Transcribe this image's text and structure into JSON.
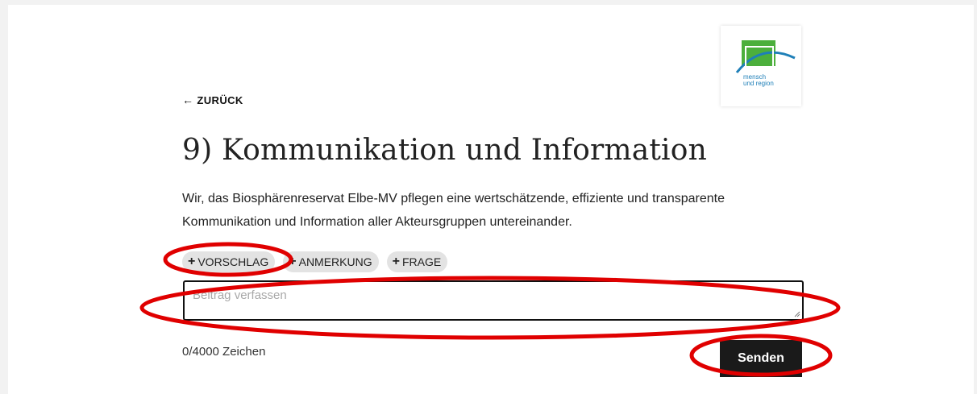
{
  "logo": {
    "line1": "mensch",
    "line2": "und region",
    "brand_green": "#4caf3c",
    "brand_blue": "#1e7fb8"
  },
  "nav": {
    "back_label": "ZURÜCK",
    "back_icon": "arrow-left-icon"
  },
  "main": {
    "title": "9) Kommunikation und Information",
    "description": "Wir, das Biosphärenreservat Elbe-MV pflegen eine wertschätzende, effiziente und transparente Kommunikation und Information aller Akteursgruppen untereinander."
  },
  "chips": [
    {
      "label": "VORSCHLAG",
      "icon": "plus-icon"
    },
    {
      "label": "ANMERKUNG",
      "icon": "plus-icon"
    },
    {
      "label": "FRAGE",
      "icon": "plus-icon"
    }
  ],
  "composer": {
    "value": "",
    "placeholder": "Beitrag verfassen",
    "counter": "0/4000 Zeichen",
    "send_label": "Senden"
  },
  "annotation_color": "#e00000"
}
